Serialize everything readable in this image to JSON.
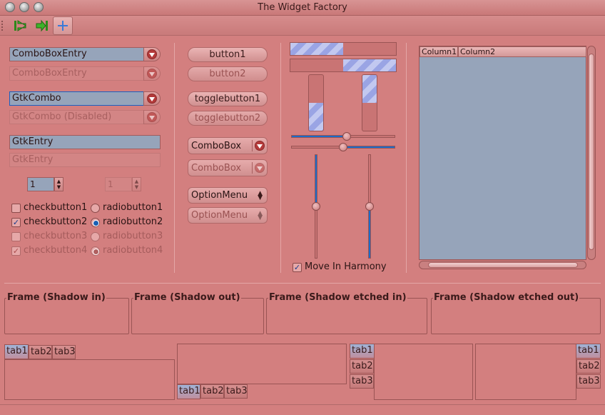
{
  "window": {
    "title": "The Widget Factory"
  },
  "toolbar": {
    "items": [
      "go-first-icon",
      "go-last-icon",
      "add-icon"
    ]
  },
  "entries": {
    "combobox_entry": "ComboBoxEntry",
    "combobox_entry_disabled": "ComboBoxEntry",
    "gtkcombo": "GtkCombo",
    "gtkcombo_disabled": "GtkCombo (Disabled)",
    "gtkentry": "GtkEntry",
    "gtkentry_disabled": "GtkEntry"
  },
  "spin": {
    "value": "1",
    "value_disabled": "1"
  },
  "checks": [
    {
      "label": "checkbutton1",
      "checked": false,
      "disabled": false
    },
    {
      "label": "checkbutton2",
      "checked": true,
      "disabled": false
    },
    {
      "label": "checkbutton3",
      "checked": false,
      "disabled": true
    },
    {
      "label": "checkbutton4",
      "checked": true,
      "disabled": true
    }
  ],
  "radios": [
    {
      "label": "radiobutton1",
      "checked": false,
      "disabled": false
    },
    {
      "label": "radiobutton2",
      "checked": true,
      "disabled": false
    },
    {
      "label": "radiobutton3",
      "checked": false,
      "disabled": true
    },
    {
      "label": "radiobutton4",
      "checked": true,
      "disabled": true
    }
  ],
  "buttons": {
    "button1": "button1",
    "button2": "button2",
    "toggle1": "togglebutton1",
    "toggle2": "togglebutton2",
    "combobox1": "ComboBox",
    "combobox2": "ComboBox",
    "optionmenu1": "OptionMenu",
    "optionmenu2": "OptionMenu"
  },
  "progress": {
    "h1": 0.5,
    "h2": 0.5,
    "v1": 0.5,
    "v2": 0.5
  },
  "scales": {
    "h1": 0.5,
    "h2": 0.5,
    "v1": 0.5,
    "v2": 0.5
  },
  "harmony": {
    "label": "Move In Harmony",
    "checked": true
  },
  "tree": {
    "columns": [
      "Column1",
      "Column2"
    ]
  },
  "frames": [
    "Frame (Shadow in)",
    "Frame (Shadow out)",
    "Frame (Shadow etched in)",
    "Frame (Shadow etched out)"
  ],
  "tabs": [
    "tab1",
    "tab2",
    "tab3"
  ],
  "colors": {
    "background": "#d37f7f",
    "entry": "#96a4ba",
    "accent": "#1c6cc8"
  }
}
